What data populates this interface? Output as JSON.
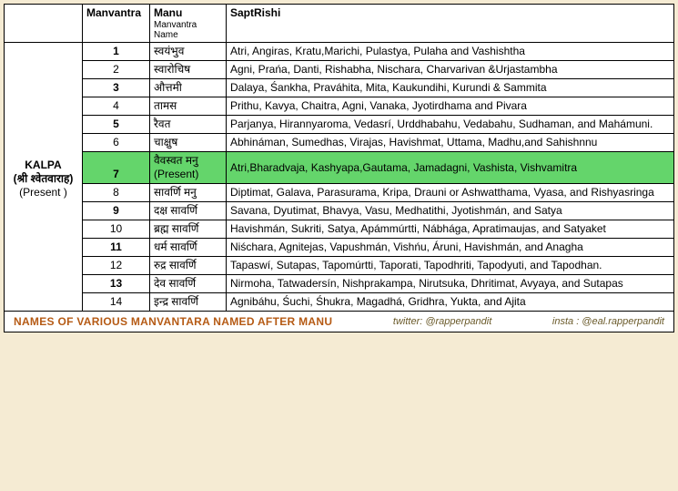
{
  "header": {
    "kalpa": "",
    "manvantra": "Manvantra",
    "manu_main": "Manu",
    "manu_sub": "Manvantra Name",
    "saptrishi": "SaptRishi"
  },
  "kalpa": {
    "label": "KALPA",
    "sub": "(श्री श्वेतवाराह)",
    "present": "(Present )"
  },
  "rows": [
    {
      "idx": "1",
      "bold": true,
      "manu": "स्वयंभुव",
      "sapt": "Atri, Angiras, Kratu,Marichi,  Pulastya, Pulaha and Vashishtha"
    },
    {
      "idx": "2",
      "bold": false,
      "manu": "स्वारोचिष",
      "sapt": "Agni, Prańa, Danti, Rishabha, Nischara, Charvarivan &Urjastambha"
    },
    {
      "idx": "3",
      "bold": true,
      "manu": "औत्तमी",
      "sapt": "Dalaya, Śankha, Praváhita, Mita, Kaukundihi, Kurundi &  Sammita"
    },
    {
      "idx": "4",
      "bold": false,
      "manu": "तामस",
      "sapt": "Prithu, Kavya, Chaitra, Agni, Vanaka, Jyotirdhama and Pivara"
    },
    {
      "idx": "5",
      "bold": true,
      "manu": "रैवत",
      "sapt": "Parjanya, Hirannyaroma, Vedasrí, Urddhabahu, Vedabahu, Sudhaman, and Mahámuni."
    },
    {
      "idx": "6",
      "bold": false,
      "manu": "चाक्षुष",
      "sapt": "Abhináman, Sumedhas, Virajas, Havishmat, Uttama, Madhu,and Sahishnnu"
    },
    {
      "idx": "7",
      "bold": true,
      "hl": true,
      "manu": "वैवस्वत मनु (Present)",
      "sapt": "Atri,Bharadvaja, Kashyapa,Gautama, Jamadagni, Vashista, Vishvamitra"
    },
    {
      "idx": "8",
      "bold": false,
      "manu": "सावर्णि मनु",
      "sapt": "Diptimat, Galava, Parasurama, Kripa, Drauni or Ashwatthama, Vyasa, and Rishyasringa"
    },
    {
      "idx": "9",
      "bold": true,
      "manu": "दक्ष सावर्णि",
      "sapt": "Savana, Dyutimat, Bhavya, Vasu, Medhatithi, Jyotishmán, and Satya"
    },
    {
      "idx": "10",
      "bold": false,
      "manu": "ब्रह्म सावर्णि",
      "sapt": "Havishmán, Sukriti, Satya, Apámmúrtti, Nábhága, Apratimaujas, and Satyaket"
    },
    {
      "idx": "11",
      "bold": true,
      "manu": "धर्म सावर्णि",
      "sapt": "Niśchara, Agnitejas, Vapushmán, Vishńu, Áruni, Havishmán, and Anagha"
    },
    {
      "idx": "12",
      "bold": false,
      "manu": "रुद्र सावर्णि",
      "sapt": "Tapaswí, Sutapas, Tapomúrtti, Taporati, Tapodhriti, Tapodyuti, and Tapodhan."
    },
    {
      "idx": "13",
      "bold": true,
      "manu": "देव सावर्णि",
      "sapt": "Nirmoha, Tatwadersín, Nishprakampa, Nirutsuka, Dhritimat, Avyaya, and Sutapas"
    },
    {
      "idx": "14",
      "bold": false,
      "manu": "इन्द्र सावर्णि",
      "sapt": "Agnibáhu, Śuchi, Śhukra, Magadhá, Gridhra, Yukta, and Ajita"
    }
  ],
  "footer": {
    "title": "NAMES OF VARIOUS MANVANTARA NAMED AFTER MANU",
    "twitter": "twitter: @rapperpandit",
    "insta": "insta : @eal.rapperpandit"
  }
}
